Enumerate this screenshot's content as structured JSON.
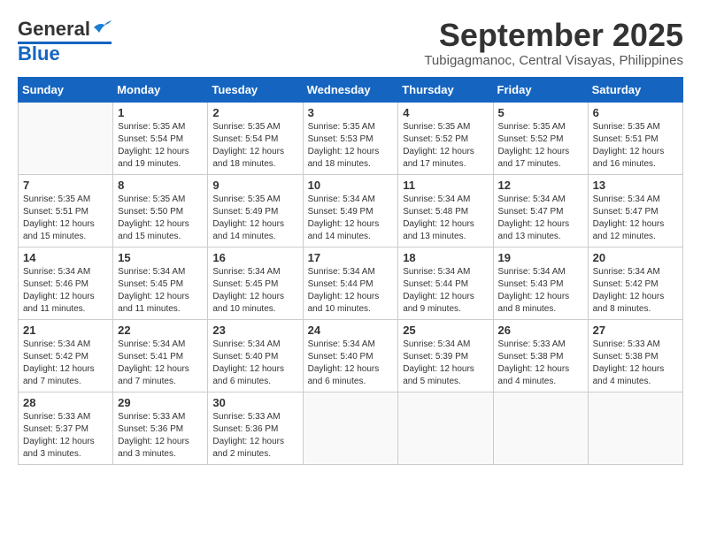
{
  "header": {
    "logo": {
      "general": "General",
      "blue": "Blue"
    },
    "month": "September 2025",
    "location": "Tubigagmanoc, Central Visayas, Philippines"
  },
  "weekdays": [
    "Sunday",
    "Monday",
    "Tuesday",
    "Wednesday",
    "Thursday",
    "Friday",
    "Saturday"
  ],
  "weeks": [
    [
      {
        "day": "",
        "info": ""
      },
      {
        "day": "1",
        "info": "Sunrise: 5:35 AM\nSunset: 5:54 PM\nDaylight: 12 hours\nand 19 minutes."
      },
      {
        "day": "2",
        "info": "Sunrise: 5:35 AM\nSunset: 5:54 PM\nDaylight: 12 hours\nand 18 minutes."
      },
      {
        "day": "3",
        "info": "Sunrise: 5:35 AM\nSunset: 5:53 PM\nDaylight: 12 hours\nand 18 minutes."
      },
      {
        "day": "4",
        "info": "Sunrise: 5:35 AM\nSunset: 5:52 PM\nDaylight: 12 hours\nand 17 minutes."
      },
      {
        "day": "5",
        "info": "Sunrise: 5:35 AM\nSunset: 5:52 PM\nDaylight: 12 hours\nand 17 minutes."
      },
      {
        "day": "6",
        "info": "Sunrise: 5:35 AM\nSunset: 5:51 PM\nDaylight: 12 hours\nand 16 minutes."
      }
    ],
    [
      {
        "day": "7",
        "info": "Sunrise: 5:35 AM\nSunset: 5:51 PM\nDaylight: 12 hours\nand 15 minutes."
      },
      {
        "day": "8",
        "info": "Sunrise: 5:35 AM\nSunset: 5:50 PM\nDaylight: 12 hours\nand 15 minutes."
      },
      {
        "day": "9",
        "info": "Sunrise: 5:35 AM\nSunset: 5:49 PM\nDaylight: 12 hours\nand 14 minutes."
      },
      {
        "day": "10",
        "info": "Sunrise: 5:34 AM\nSunset: 5:49 PM\nDaylight: 12 hours\nand 14 minutes."
      },
      {
        "day": "11",
        "info": "Sunrise: 5:34 AM\nSunset: 5:48 PM\nDaylight: 12 hours\nand 13 minutes."
      },
      {
        "day": "12",
        "info": "Sunrise: 5:34 AM\nSunset: 5:47 PM\nDaylight: 12 hours\nand 13 minutes."
      },
      {
        "day": "13",
        "info": "Sunrise: 5:34 AM\nSunset: 5:47 PM\nDaylight: 12 hours\nand 12 minutes."
      }
    ],
    [
      {
        "day": "14",
        "info": "Sunrise: 5:34 AM\nSunset: 5:46 PM\nDaylight: 12 hours\nand 11 minutes."
      },
      {
        "day": "15",
        "info": "Sunrise: 5:34 AM\nSunset: 5:45 PM\nDaylight: 12 hours\nand 11 minutes."
      },
      {
        "day": "16",
        "info": "Sunrise: 5:34 AM\nSunset: 5:45 PM\nDaylight: 12 hours\nand 10 minutes."
      },
      {
        "day": "17",
        "info": "Sunrise: 5:34 AM\nSunset: 5:44 PM\nDaylight: 12 hours\nand 10 minutes."
      },
      {
        "day": "18",
        "info": "Sunrise: 5:34 AM\nSunset: 5:44 PM\nDaylight: 12 hours\nand 9 minutes."
      },
      {
        "day": "19",
        "info": "Sunrise: 5:34 AM\nSunset: 5:43 PM\nDaylight: 12 hours\nand 8 minutes."
      },
      {
        "day": "20",
        "info": "Sunrise: 5:34 AM\nSunset: 5:42 PM\nDaylight: 12 hours\nand 8 minutes."
      }
    ],
    [
      {
        "day": "21",
        "info": "Sunrise: 5:34 AM\nSunset: 5:42 PM\nDaylight: 12 hours\nand 7 minutes."
      },
      {
        "day": "22",
        "info": "Sunrise: 5:34 AM\nSunset: 5:41 PM\nDaylight: 12 hours\nand 7 minutes."
      },
      {
        "day": "23",
        "info": "Sunrise: 5:34 AM\nSunset: 5:40 PM\nDaylight: 12 hours\nand 6 minutes."
      },
      {
        "day": "24",
        "info": "Sunrise: 5:34 AM\nSunset: 5:40 PM\nDaylight: 12 hours\nand 6 minutes."
      },
      {
        "day": "25",
        "info": "Sunrise: 5:34 AM\nSunset: 5:39 PM\nDaylight: 12 hours\nand 5 minutes."
      },
      {
        "day": "26",
        "info": "Sunrise: 5:33 AM\nSunset: 5:38 PM\nDaylight: 12 hours\nand 4 minutes."
      },
      {
        "day": "27",
        "info": "Sunrise: 5:33 AM\nSunset: 5:38 PM\nDaylight: 12 hours\nand 4 minutes."
      }
    ],
    [
      {
        "day": "28",
        "info": "Sunrise: 5:33 AM\nSunset: 5:37 PM\nDaylight: 12 hours\nand 3 minutes."
      },
      {
        "day": "29",
        "info": "Sunrise: 5:33 AM\nSunset: 5:36 PM\nDaylight: 12 hours\nand 3 minutes."
      },
      {
        "day": "30",
        "info": "Sunrise: 5:33 AM\nSunset: 5:36 PM\nDaylight: 12 hours\nand 2 minutes."
      },
      {
        "day": "",
        "info": ""
      },
      {
        "day": "",
        "info": ""
      },
      {
        "day": "",
        "info": ""
      },
      {
        "day": "",
        "info": ""
      }
    ]
  ]
}
